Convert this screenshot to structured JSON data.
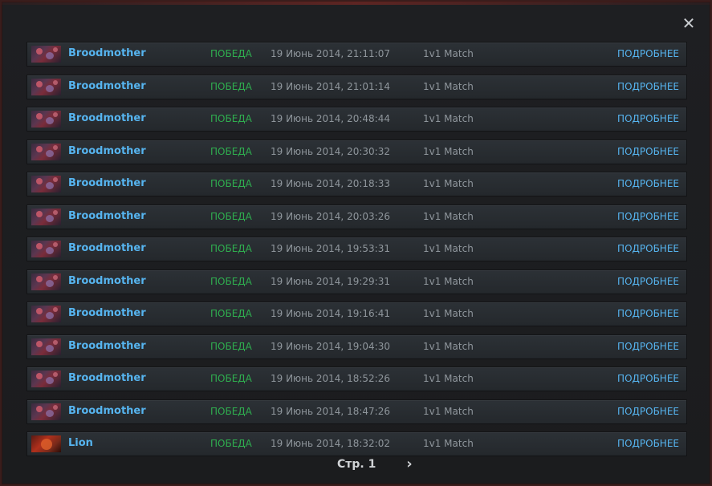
{
  "close_glyph": "✕",
  "matches": [
    {
      "hero": "Broodmother",
      "icon": "broodmother-portrait",
      "result": "ПОБЕДА",
      "date": "19 Июнь 2014, 21:11:07",
      "mode": "1v1 Match",
      "details": "ПОДРОБНЕЕ"
    },
    {
      "hero": "Broodmother",
      "icon": "broodmother-portrait",
      "result": "ПОБЕДА",
      "date": "19 Июнь 2014, 21:01:14",
      "mode": "1v1 Match",
      "details": "ПОДРОБНЕЕ"
    },
    {
      "hero": "Broodmother",
      "icon": "broodmother-portrait",
      "result": "ПОБЕДА",
      "date": "19 Июнь 2014, 20:48:44",
      "mode": "1v1 Match",
      "details": "ПОДРОБНЕЕ"
    },
    {
      "hero": "Broodmother",
      "icon": "broodmother-portrait",
      "result": "ПОБЕДА",
      "date": "19 Июнь 2014, 20:30:32",
      "mode": "1v1 Match",
      "details": "ПОДРОБНЕЕ"
    },
    {
      "hero": "Broodmother",
      "icon": "broodmother-portrait",
      "result": "ПОБЕДА",
      "date": "19 Июнь 2014, 20:18:33",
      "mode": "1v1 Match",
      "details": "ПОДРОБНЕЕ"
    },
    {
      "hero": "Broodmother",
      "icon": "broodmother-portrait",
      "result": "ПОБЕДА",
      "date": "19 Июнь 2014, 20:03:26",
      "mode": "1v1 Match",
      "details": "ПОДРОБНЕЕ"
    },
    {
      "hero": "Broodmother",
      "icon": "broodmother-portrait",
      "result": "ПОБЕДА",
      "date": "19 Июнь 2014, 19:53:31",
      "mode": "1v1 Match",
      "details": "ПОДРОБНЕЕ"
    },
    {
      "hero": "Broodmother",
      "icon": "broodmother-portrait",
      "result": "ПОБЕДА",
      "date": "19 Июнь 2014, 19:29:31",
      "mode": "1v1 Match",
      "details": "ПОДРОБНЕЕ"
    },
    {
      "hero": "Broodmother",
      "icon": "broodmother-portrait",
      "result": "ПОБЕДА",
      "date": "19 Июнь 2014, 19:16:41",
      "mode": "1v1 Match",
      "details": "ПОДРОБНЕЕ"
    },
    {
      "hero": "Broodmother",
      "icon": "broodmother-portrait",
      "result": "ПОБЕДА",
      "date": "19 Июнь 2014, 19:04:30",
      "mode": "1v1 Match",
      "details": "ПОДРОБНЕЕ"
    },
    {
      "hero": "Broodmother",
      "icon": "broodmother-portrait",
      "result": "ПОБЕДА",
      "date": "19 Июнь 2014, 18:52:26",
      "mode": "1v1 Match",
      "details": "ПОДРОБНЕЕ"
    },
    {
      "hero": "Broodmother",
      "icon": "broodmother-portrait",
      "result": "ПОБЕДА",
      "date": "19 Июнь 2014, 18:47:26",
      "mode": "1v1 Match",
      "details": "ПОДРОБНЕЕ"
    },
    {
      "hero": "Lion",
      "icon": "lion-portrait",
      "result": "ПОБЕДА",
      "date": "19 Июнь 2014, 18:32:02",
      "mode": "1v1 Match",
      "details": "ПОДРОБНЕЕ"
    }
  ],
  "pager": {
    "label": "Стр. 1",
    "next_glyph": "›"
  },
  "colors": {
    "hero_name": "#56b4ef",
    "win": "#2fae4f",
    "muted": "#8f969c",
    "link": "#56b4ef"
  }
}
